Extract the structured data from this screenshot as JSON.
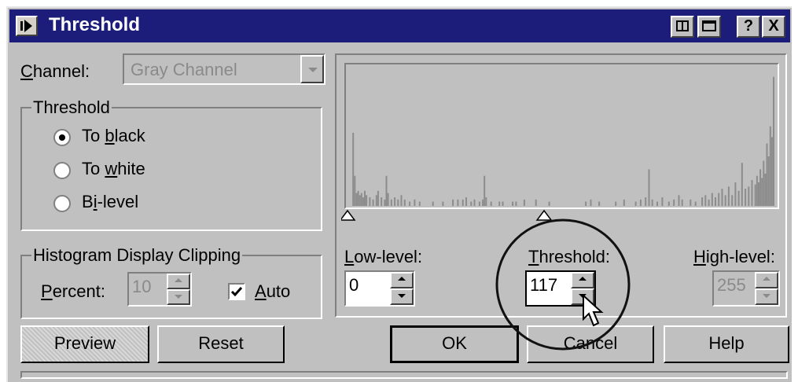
{
  "window": {
    "title": "Threshold",
    "title_bg": "#1c1c7a",
    "controls": [
      "?",
      "X"
    ]
  },
  "channel": {
    "label": "Channel:",
    "value": "Gray Channel"
  },
  "threshold_group": {
    "legend": "Threshold",
    "options": [
      {
        "label": "To black",
        "selected": true
      },
      {
        "label": "To white",
        "selected": false
      },
      {
        "label": "Bi-level",
        "selected": false
      }
    ]
  },
  "clipping_group": {
    "legend": "Histogram Display Clipping",
    "percent_label": "Percent:",
    "percent_value": "10",
    "auto_label": "Auto",
    "auto_checked": true
  },
  "levels": {
    "low_label": "Low-level:",
    "low_value": "0",
    "threshold_label": "Threshold:",
    "threshold_value": "117",
    "high_label": "High-level:",
    "high_value": "255"
  },
  "buttons": {
    "preview": "Preview",
    "reset": "Reset",
    "ok": "OK",
    "cancel": "Cancel",
    "help": "Help"
  },
  "histogram": {
    "bar_color": "#8c8c8c",
    "markers": {
      "low": 0,
      "threshold": 117
    },
    "bins": [
      [
        2,
        68
      ],
      [
        3,
        28
      ],
      [
        4,
        12
      ],
      [
        5,
        14
      ],
      [
        6,
        10
      ],
      [
        7,
        12
      ],
      [
        8,
        8
      ],
      [
        9,
        14
      ],
      [
        10,
        10
      ],
      [
        12,
        8
      ],
      [
        14,
        6
      ],
      [
        16,
        10
      ],
      [
        17,
        14
      ],
      [
        19,
        8
      ],
      [
        21,
        6
      ],
      [
        22,
        28
      ],
      [
        23,
        12
      ],
      [
        25,
        6
      ],
      [
        27,
        8
      ],
      [
        29,
        6
      ],
      [
        31,
        10
      ],
      [
        33,
        6
      ],
      [
        36,
        4
      ],
      [
        39,
        6
      ],
      [
        42,
        4
      ],
      [
        50,
        4
      ],
      [
        56,
        4
      ],
      [
        62,
        6
      ],
      [
        65,
        6
      ],
      [
        68,
        6
      ],
      [
        70,
        8
      ],
      [
        73,
        4
      ],
      [
        75,
        6
      ],
      [
        78,
        4
      ],
      [
        80,
        6
      ],
      [
        81,
        28
      ],
      [
        82,
        8
      ],
      [
        85,
        4
      ],
      [
        90,
        4
      ],
      [
        92,
        4
      ],
      [
        98,
        4
      ],
      [
        100,
        4
      ],
      [
        105,
        6
      ],
      [
        112,
        6
      ],
      [
        120,
        4
      ],
      [
        142,
        4
      ],
      [
        145,
        6
      ],
      [
        150,
        4
      ],
      [
        160,
        4
      ],
      [
        165,
        6
      ],
      [
        172,
        4
      ],
      [
        175,
        6
      ],
      [
        178,
        8
      ],
      [
        180,
        34
      ],
      [
        182,
        6
      ],
      [
        185,
        4
      ],
      [
        188,
        8
      ],
      [
        192,
        4
      ],
      [
        195,
        6
      ],
      [
        198,
        10
      ],
      [
        200,
        6
      ],
      [
        205,
        6
      ],
      [
        208,
        4
      ],
      [
        212,
        8
      ],
      [
        214,
        10
      ],
      [
        216,
        6
      ],
      [
        218,
        12
      ],
      [
        220,
        8
      ],
      [
        222,
        12
      ],
      [
        224,
        16
      ],
      [
        226,
        10
      ],
      [
        228,
        18
      ],
      [
        230,
        10
      ],
      [
        232,
        22
      ],
      [
        234,
        14
      ],
      [
        236,
        40
      ],
      [
        238,
        16
      ],
      [
        240,
        18
      ],
      [
        242,
        24
      ],
      [
        244,
        20
      ],
      [
        245,
        28
      ],
      [
        246,
        22
      ],
      [
        247,
        34
      ],
      [
        248,
        26
      ],
      [
        249,
        42
      ],
      [
        250,
        30
      ],
      [
        251,
        58
      ],
      [
        252,
        46
      ],
      [
        253,
        74
      ],
      [
        254,
        64
      ],
      [
        255,
        120
      ]
    ]
  }
}
